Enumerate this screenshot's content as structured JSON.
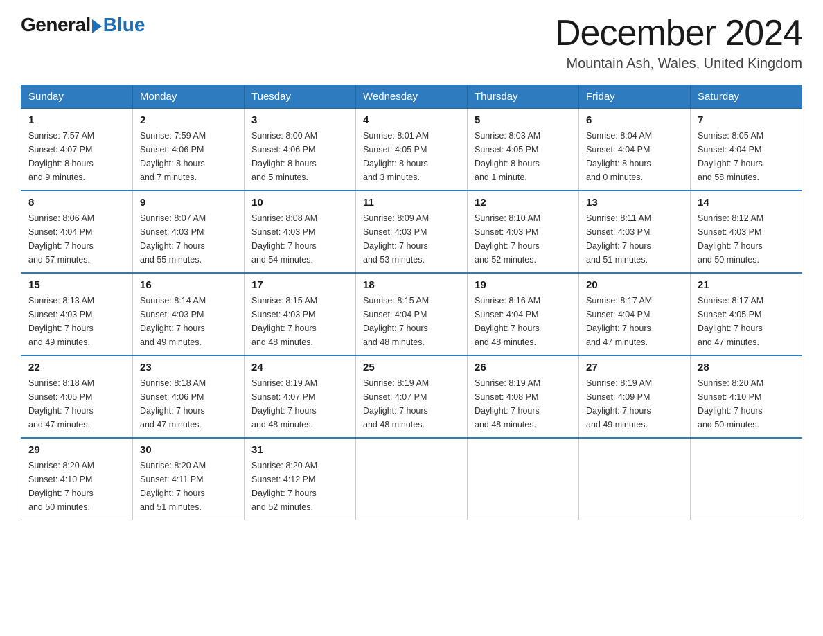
{
  "header": {
    "logo_general": "General",
    "logo_blue": "Blue",
    "month_title": "December 2024",
    "location": "Mountain Ash, Wales, United Kingdom"
  },
  "weekdays": [
    "Sunday",
    "Monday",
    "Tuesday",
    "Wednesday",
    "Thursday",
    "Friday",
    "Saturday"
  ],
  "weeks": [
    [
      {
        "day": "1",
        "sunrise": "7:57 AM",
        "sunset": "4:07 PM",
        "daylight": "8 hours and 9 minutes."
      },
      {
        "day": "2",
        "sunrise": "7:59 AM",
        "sunset": "4:06 PM",
        "daylight": "8 hours and 7 minutes."
      },
      {
        "day": "3",
        "sunrise": "8:00 AM",
        "sunset": "4:06 PM",
        "daylight": "8 hours and 5 minutes."
      },
      {
        "day": "4",
        "sunrise": "8:01 AM",
        "sunset": "4:05 PM",
        "daylight": "8 hours and 3 minutes."
      },
      {
        "day": "5",
        "sunrise": "8:03 AM",
        "sunset": "4:05 PM",
        "daylight": "8 hours and 1 minute."
      },
      {
        "day": "6",
        "sunrise": "8:04 AM",
        "sunset": "4:04 PM",
        "daylight": "8 hours and 0 minutes."
      },
      {
        "day": "7",
        "sunrise": "8:05 AM",
        "sunset": "4:04 PM",
        "daylight": "7 hours and 58 minutes."
      }
    ],
    [
      {
        "day": "8",
        "sunrise": "8:06 AM",
        "sunset": "4:04 PM",
        "daylight": "7 hours and 57 minutes."
      },
      {
        "day": "9",
        "sunrise": "8:07 AM",
        "sunset": "4:03 PM",
        "daylight": "7 hours and 55 minutes."
      },
      {
        "day": "10",
        "sunrise": "8:08 AM",
        "sunset": "4:03 PM",
        "daylight": "7 hours and 54 minutes."
      },
      {
        "day": "11",
        "sunrise": "8:09 AM",
        "sunset": "4:03 PM",
        "daylight": "7 hours and 53 minutes."
      },
      {
        "day": "12",
        "sunrise": "8:10 AM",
        "sunset": "4:03 PM",
        "daylight": "7 hours and 52 minutes."
      },
      {
        "day": "13",
        "sunrise": "8:11 AM",
        "sunset": "4:03 PM",
        "daylight": "7 hours and 51 minutes."
      },
      {
        "day": "14",
        "sunrise": "8:12 AM",
        "sunset": "4:03 PM",
        "daylight": "7 hours and 50 minutes."
      }
    ],
    [
      {
        "day": "15",
        "sunrise": "8:13 AM",
        "sunset": "4:03 PM",
        "daylight": "7 hours and 49 minutes."
      },
      {
        "day": "16",
        "sunrise": "8:14 AM",
        "sunset": "4:03 PM",
        "daylight": "7 hours and 49 minutes."
      },
      {
        "day": "17",
        "sunrise": "8:15 AM",
        "sunset": "4:03 PM",
        "daylight": "7 hours and 48 minutes."
      },
      {
        "day": "18",
        "sunrise": "8:15 AM",
        "sunset": "4:04 PM",
        "daylight": "7 hours and 48 minutes."
      },
      {
        "day": "19",
        "sunrise": "8:16 AM",
        "sunset": "4:04 PM",
        "daylight": "7 hours and 48 minutes."
      },
      {
        "day": "20",
        "sunrise": "8:17 AM",
        "sunset": "4:04 PM",
        "daylight": "7 hours and 47 minutes."
      },
      {
        "day": "21",
        "sunrise": "8:17 AM",
        "sunset": "4:05 PM",
        "daylight": "7 hours and 47 minutes."
      }
    ],
    [
      {
        "day": "22",
        "sunrise": "8:18 AM",
        "sunset": "4:05 PM",
        "daylight": "7 hours and 47 minutes."
      },
      {
        "day": "23",
        "sunrise": "8:18 AM",
        "sunset": "4:06 PM",
        "daylight": "7 hours and 47 minutes."
      },
      {
        "day": "24",
        "sunrise": "8:19 AM",
        "sunset": "4:07 PM",
        "daylight": "7 hours and 48 minutes."
      },
      {
        "day": "25",
        "sunrise": "8:19 AM",
        "sunset": "4:07 PM",
        "daylight": "7 hours and 48 minutes."
      },
      {
        "day": "26",
        "sunrise": "8:19 AM",
        "sunset": "4:08 PM",
        "daylight": "7 hours and 48 minutes."
      },
      {
        "day": "27",
        "sunrise": "8:19 AM",
        "sunset": "4:09 PM",
        "daylight": "7 hours and 49 minutes."
      },
      {
        "day": "28",
        "sunrise": "8:20 AM",
        "sunset": "4:10 PM",
        "daylight": "7 hours and 50 minutes."
      }
    ],
    [
      {
        "day": "29",
        "sunrise": "8:20 AM",
        "sunset": "4:10 PM",
        "daylight": "7 hours and 50 minutes."
      },
      {
        "day": "30",
        "sunrise": "8:20 AM",
        "sunset": "4:11 PM",
        "daylight": "7 hours and 51 minutes."
      },
      {
        "day": "31",
        "sunrise": "8:20 AM",
        "sunset": "4:12 PM",
        "daylight": "7 hours and 52 minutes."
      },
      null,
      null,
      null,
      null
    ]
  ],
  "labels": {
    "sunrise": "Sunrise:",
    "sunset": "Sunset:",
    "daylight": "Daylight:"
  }
}
